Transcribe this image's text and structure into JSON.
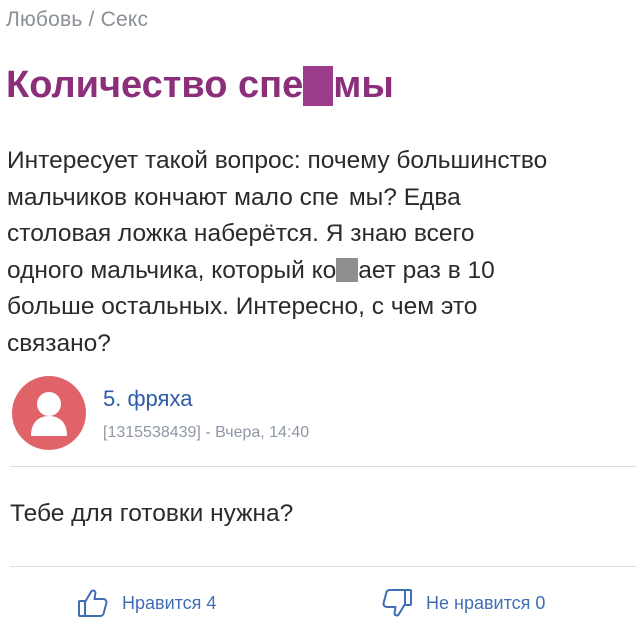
{
  "breadcrumb": {
    "first": "Любовь",
    "separator": "/",
    "second": "Секс"
  },
  "title": {
    "part1": "Количество спе",
    "part2": "мы"
  },
  "body": {
    "line1": "Интересует такой вопрос: почему большинство",
    "line2a": "мальчиков кончают мало спе",
    "line2b": "мы? Едва",
    "line3": "столовая ложка наберётся. Я знаю всего",
    "line4a": "одного мальчика, который ко",
    "line4b": "ает раз в 10",
    "line5": "больше остальных. Интересно, с чем это",
    "line6": "связано?"
  },
  "answer": {
    "author": "5. фряха",
    "meta": "[1315538439] - Вчера, 14:40",
    "text": "Тебе для готовки нужна?"
  },
  "reactions": {
    "like_label": "Нравится 4",
    "dislike_label": "Не нравится 0"
  },
  "colors": {
    "title": "#8b2f7a",
    "censor": "#9c3d8c",
    "link": "#2d5da8",
    "avatar": "#e0636a",
    "reaction": "#3f6eb5"
  },
  "icons": {
    "avatar": "user-silhouette-icon",
    "like": "thumbs-up-icon",
    "dislike": "thumbs-down-icon"
  }
}
